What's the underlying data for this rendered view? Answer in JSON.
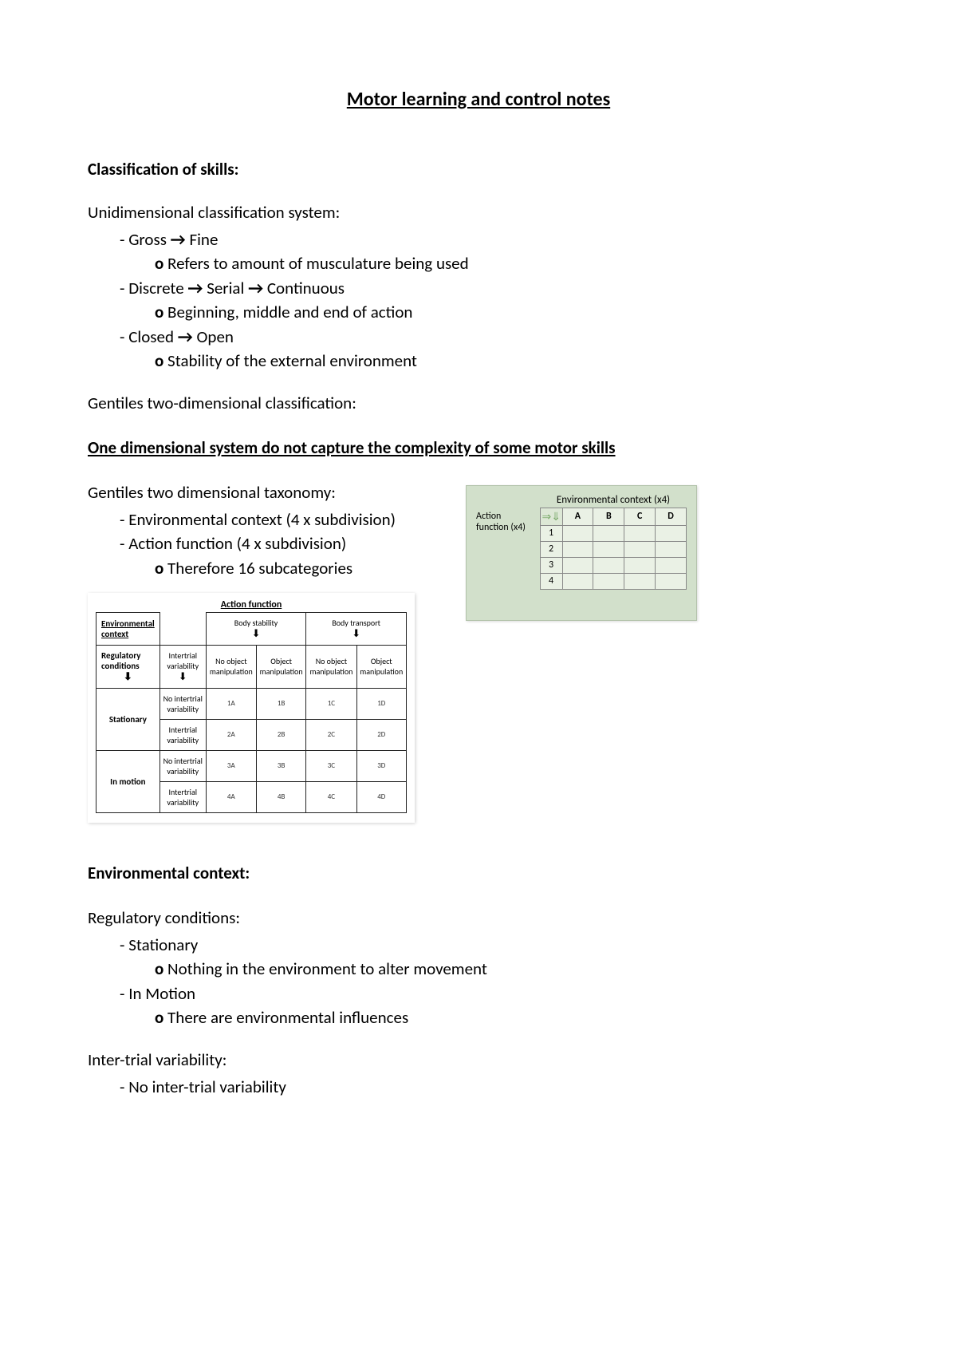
{
  "title": "Motor learning and control notes",
  "section1_heading": "Classification of skills:",
  "unidim_heading": "Unidimensional classification system:",
  "u1": {
    "a": "Gross",
    "b": "Fine",
    "sub": "Refers to amount of musculature being used"
  },
  "u2": {
    "a": "Discrete",
    "b": "Serial",
    "c": "Continuous",
    "sub": "Beginning, middle and end of action"
  },
  "u3": {
    "a": "Closed",
    "b": "Open",
    "sub": "Stability of the external environment"
  },
  "gentile_heading": "Gentiles two-dimensional classification:",
  "single_dim_line": "One dimensional system do not capture the complexity of some motor skills",
  "taxonomy_heading": "Gentiles two dimensional taxonomy:",
  "tax_env": "Environmental context (4 x subdivision)",
  "tax_act": "Action function (4 x subdivision)",
  "tax_sub": "Therefore 16 subcategories",
  "big_table": {
    "action_function": "Action function",
    "env_context": "Environmental context",
    "body_stability": "Body stability",
    "body_transport": "Body transport",
    "regulatory_conditions": "Regulatory conditions",
    "intertrial_variability": "Intertrial variability",
    "no_obj": "No object manipulation",
    "obj": "Object manipulation",
    "stationary": "Stationary",
    "in_motion": "In motion",
    "no_itv": "No intertrial variability",
    "itv": "Intertrial variability",
    "cells": {
      "r1": [
        "1A",
        "1B",
        "1C",
        "1D"
      ],
      "r2": [
        "2A",
        "2B",
        "2C",
        "2D"
      ],
      "r3": [
        "3A",
        "3B",
        "3C",
        "3D"
      ],
      "r4": [
        "4A",
        "4B",
        "4C",
        "4D"
      ]
    }
  },
  "mini": {
    "env_title": "Environmental context (x4)",
    "action_title": "Action function (x4)",
    "cols": [
      "A",
      "B",
      "C",
      "D"
    ],
    "rows": [
      "1",
      "2",
      "3",
      "4"
    ]
  },
  "env_context_heading": "Environmental context:",
  "regcond_heading": "Regulatory conditions:",
  "reg_stationary": "Stationary",
  "reg_stationary_sub": "Nothing in the environment to alter movement",
  "reg_inmotion": "In Motion",
  "reg_inmotion_sub": "There are environmental influences",
  "itv_heading": "Inter-trial variability:",
  "itv_none": "No inter-trial variability"
}
